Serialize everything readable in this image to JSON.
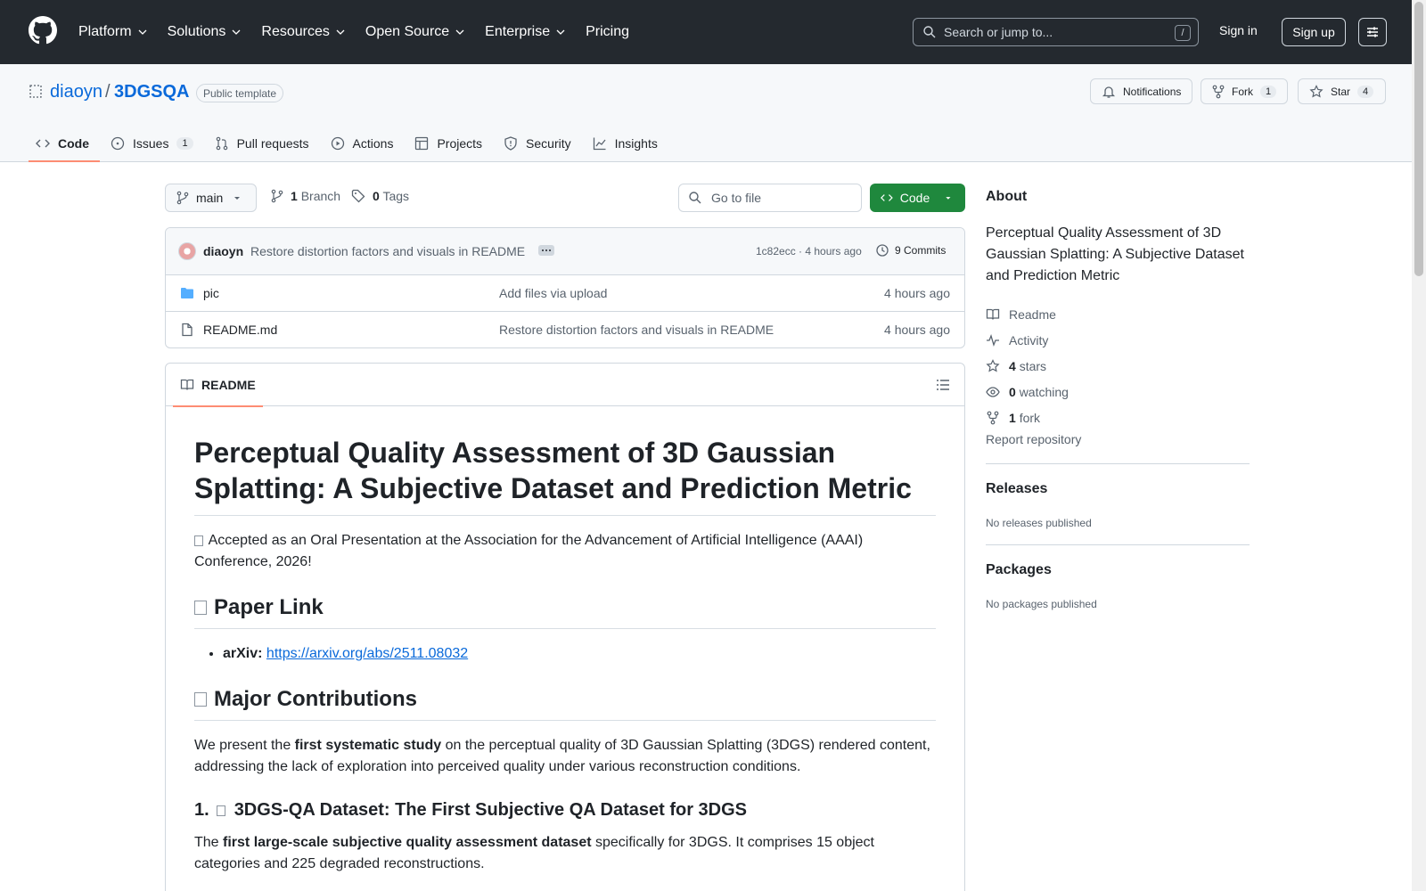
{
  "header": {
    "nav": [
      "Platform",
      "Solutions",
      "Resources",
      "Open Source",
      "Enterprise",
      "Pricing"
    ],
    "search_placeholder": "Search or jump to...",
    "search_shortcut": "/",
    "signin": "Sign in",
    "signup": "Sign up"
  },
  "repo": {
    "owner": "diaoyn",
    "separator": "/",
    "name": "3DGSQA",
    "visibility": "Public template",
    "notifications": "Notifications",
    "fork_label": "Fork",
    "fork_count": "1",
    "star_label": "Star",
    "star_count": "4"
  },
  "tabs": [
    {
      "label": "Code",
      "count": ""
    },
    {
      "label": "Issues",
      "count": "1"
    },
    {
      "label": "Pull requests",
      "count": ""
    },
    {
      "label": "Actions",
      "count": ""
    },
    {
      "label": "Projects",
      "count": ""
    },
    {
      "label": "Security",
      "count": ""
    },
    {
      "label": "Insights",
      "count": ""
    }
  ],
  "toolbar": {
    "branch": "main",
    "branch_count": "1",
    "branch_label": "Branch",
    "tag_count": "0",
    "tag_label": "Tags",
    "goto_placeholder": "Go to file",
    "code_button": "Code"
  },
  "commit": {
    "author": "diaoyn",
    "message": "Restore distortion factors and visuals in README",
    "hash_time": "1c82ecc · 4 hours ago",
    "commits": "9 Commits"
  },
  "files": [
    {
      "name": "pic",
      "type": "folder",
      "message": "Add files via upload",
      "time": "4 hours ago"
    },
    {
      "name": "README.md",
      "type": "file",
      "message": "Restore distortion factors and visuals in README",
      "time": "4 hours ago"
    }
  ],
  "readme": {
    "tab": "README",
    "title": "Perceptual Quality Assessment of 3D Gaussian Splatting: A Subjective Dataset and Prediction Metric",
    "accepted": "Accepted as an Oral Presentation at the Association for the Advancement of Artificial Intelligence (AAAI) Conference, 2026!",
    "h_paper": "Paper Link",
    "arxiv_label": "arXiv:",
    "arxiv_url": "https://arxiv.org/abs/2511.08032",
    "h_contrib": "Major Contributions",
    "contrib_pre": "We present the ",
    "contrib_bold": "first systematic study",
    "contrib_post": " on the perceptual quality of 3D Gaussian Splatting (3DGS) rendered content, addressing the lack of exploration into perceived quality under various reconstruction conditions.",
    "h3_num": "1.",
    "h3_text": "3DGS-QA Dataset: The First Subjective QA Dataset for 3DGS",
    "ds_pre": "The ",
    "ds_bold": "first large-scale subjective quality assessment dataset",
    "ds_post": " specifically for 3DGS. It comprises 15 object categories and 225 degraded reconstructions."
  },
  "about": {
    "heading": "About",
    "description": "Perceptual Quality Assessment of 3D Gaussian Splatting: A Subjective Dataset and Prediction Metric",
    "readme": "Readme",
    "activity": "Activity",
    "stars_n": "4",
    "stars": "stars",
    "watching_n": "0",
    "watching": "watching",
    "fork_n": "1",
    "fork": "fork",
    "report": "Report repository"
  },
  "releases": {
    "heading": "Releases",
    "text": "No releases published"
  },
  "packages": {
    "heading": "Packages",
    "text": "No packages published"
  }
}
